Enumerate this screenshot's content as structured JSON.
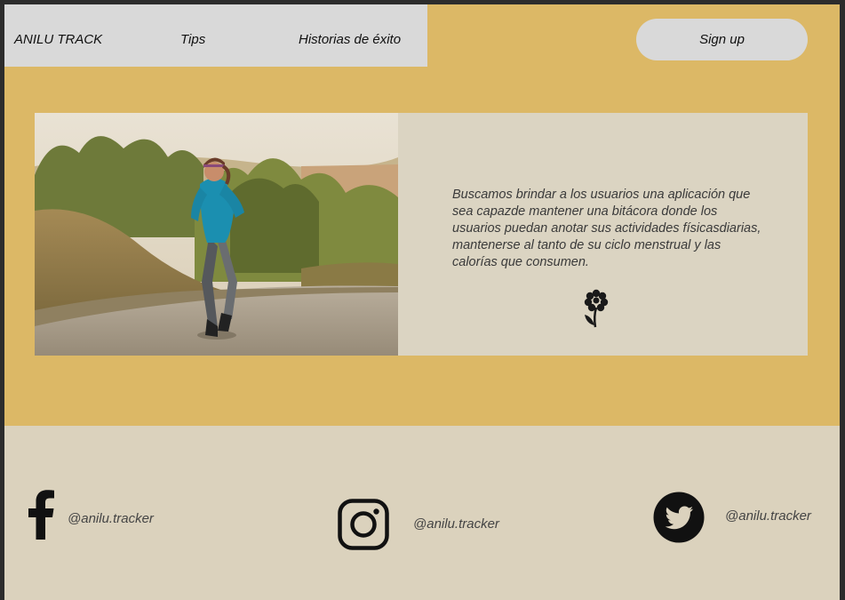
{
  "nav": {
    "brand": "ANILU TRACK",
    "tips": "Tips",
    "stories": "Historias de éxito",
    "signup": "Sign up"
  },
  "hero": {
    "description": "Buscamos brindar a los usuarios una aplicación que sea capazde mantener una bitácora donde los usuarios puedan anotar sus actividades físicasdiarias, mantenerse al tanto de su ciclo menstrual y las calorías que consumen."
  },
  "footer": {
    "facebook_handle": "@anilu.tracker",
    "instagram_handle": "@anilu.tracker",
    "twitter_handle": "@anilu.tracker"
  },
  "colors": {
    "mustard": "#dcb866",
    "nav_gray": "#d9d9d9",
    "panel_beige": "#dbd4c2",
    "footer_beige": "#dbd2bd"
  }
}
